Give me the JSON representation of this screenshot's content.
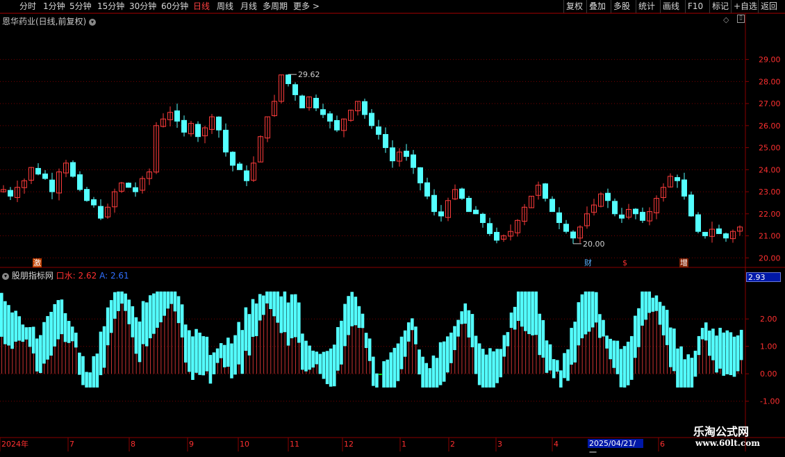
{
  "toolbar": {
    "periods": [
      "分时",
      "1分钟",
      "5分钟",
      "15分钟",
      "30分钟",
      "60分钟",
      "日线",
      "周线",
      "月线",
      "多周期",
      "更多 >"
    ],
    "active_period": "日线",
    "right_buttons": [
      "复权",
      "叠加",
      "多股",
      "统计",
      "画线",
      "F10",
      "标记",
      "+自选",
      "返回"
    ]
  },
  "chart_title": "恩华药业(日线,前复权)",
  "indicator": {
    "name": "股朋指标网",
    "label1": "口水:",
    "value1": "2.62",
    "label2": "A:",
    "value2": "2.61"
  },
  "value_box": "2.93",
  "date_box": "2025/04/21/一",
  "watermark": {
    "name": "乐淘公式网",
    "url": "www.60lt.com"
  },
  "price_markers": {
    "high": "29.62",
    "low": "20.00"
  },
  "event_tags": [
    "激",
    "财",
    "$",
    "增"
  ],
  "colors": {
    "up": "#ff3c3c",
    "down": "#54ffff",
    "negative": "#00ff00",
    "frame": "#8a0000",
    "grid": "#7a0000"
  },
  "chart_data": [
    {
      "type": "candlestick",
      "yticks": [
        "29.00",
        "28.00",
        "27.00",
        "26.00",
        "25.00",
        "24.00",
        "23.00",
        "22.00",
        "21.00",
        "20.00"
      ],
      "ylim": [
        19.6,
        30.5
      ],
      "closes": [
        23.1,
        22.8,
        23.2,
        23.5,
        24.1,
        23.8,
        23.6,
        23.0,
        23.9,
        24.3,
        23.7,
        23.1,
        22.6,
        22.4,
        21.8,
        22.3,
        23.0,
        23.4,
        23.2,
        23.0,
        23.6,
        23.9,
        26.0,
        26.3,
        26.6,
        26.2,
        25.7,
        26.1,
        25.5,
        25.9,
        26.4,
        25.8,
        24.8,
        24.2,
        24.0,
        23.5,
        24.3,
        25.5,
        26.4,
        27.1,
        28.3,
        27.9,
        27.4,
        26.8,
        27.3,
        26.8,
        26.5,
        26.2,
        25.8,
        26.3,
        26.7,
        27.1,
        26.5,
        26.0,
        25.6,
        25.0,
        24.4,
        24.8,
        24.6,
        24.1,
        23.4,
        22.8,
        22.1,
        21.9,
        22.6,
        23.1,
        22.7,
        22.1,
        22.0,
        21.6,
        21.1,
        20.8,
        21.0,
        21.2,
        21.7,
        22.3,
        22.8,
        23.3,
        22.7,
        22.1,
        21.6,
        21.2,
        20.9,
        21.4,
        22.0,
        22.4,
        22.9,
        22.6,
        22.0,
        21.8,
        22.2,
        22.0,
        21.7,
        22.1,
        22.7,
        23.2,
        23.7,
        23.5,
        22.8,
        21.9,
        21.2,
        21.0,
        21.3,
        21.1,
        20.9,
        21.2,
        21.4
      ],
      "n": 107
    },
    {
      "type": "bar",
      "yticks": [
        "2.00",
        "1.00",
        "0.00",
        "-1.00"
      ],
      "ylim": [
        -2.3,
        3.5
      ],
      "x_labels": [
        "2024年",
        "7",
        "8",
        "9",
        "10",
        "11",
        "12",
        "1",
        "2",
        "3",
        "4",
        "6"
      ]
    }
  ]
}
